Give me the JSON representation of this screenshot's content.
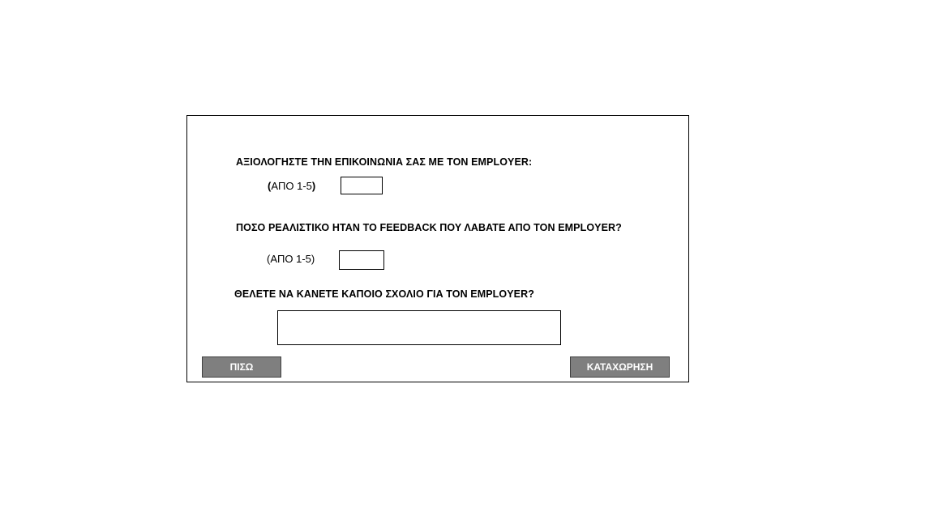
{
  "form": {
    "q1_label": "ΑΞΙΟΛΟΓΗΣΤΕ ΤΗΝ ΕΠΙΚΟΙΝΩΝΙΑ ΣΑΣ ΜΕ ΤΟΝ EMPLOYER:",
    "q1_scale_open": "(",
    "q1_scale_text": "ΑΠΟ 1-5",
    "q1_scale_close": ")",
    "q1_value": "",
    "q2_label": "ΠΟΣΟ ΡΕΑΛΙΣΤΙΚΟ ΗΤΑΝ ΤΟ FEEDBACK ΠΟΥ ΛΑΒΑΤΕ ΑΠΟ ΤΟΝ EMPLOYER?",
    "q2_scale": "(ΑΠΟ 1-5)",
    "q2_value": "",
    "q3_label": "ΘΕΛΕΤΕ ΝΑ ΚΑΝΕΤΕ ΚΑΠΟΙΟ ΣΧΟΛΙΟ ΓΙΑ ΤΟΝ EMPLOYER?",
    "comment_value": ""
  },
  "buttons": {
    "back_label": "ΠΙΣΩ",
    "submit_label": "ΚΑΤΑΧΩΡΗΣΗ",
    "color": "#7f7f7f"
  }
}
